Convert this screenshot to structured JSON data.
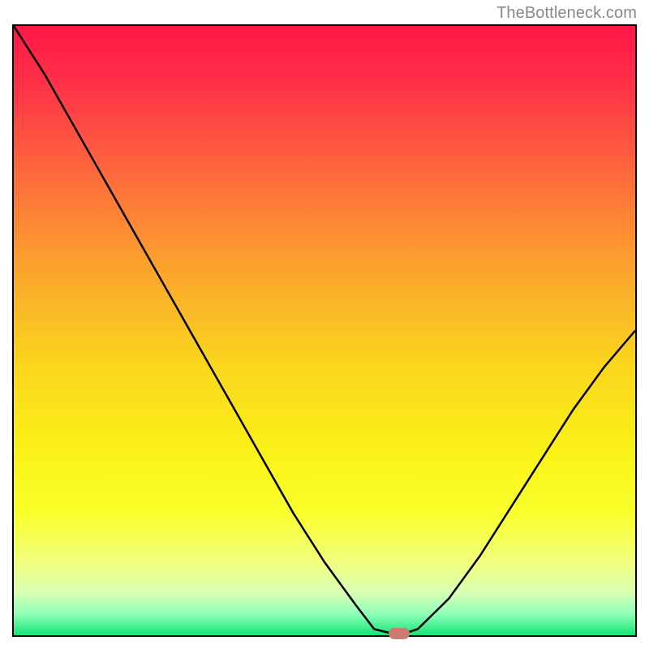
{
  "watermark": "TheBottleneck.com",
  "chart_data": {
    "type": "line",
    "title": "",
    "xlabel": "",
    "ylabel": "",
    "xlim": [
      0,
      100
    ],
    "ylim": [
      0,
      100
    ],
    "grid": false,
    "legend": false,
    "series": [
      {
        "name": "bottleneck-curve",
        "x": [
          0,
          5,
          10,
          15,
          20,
          25,
          30,
          35,
          40,
          45,
          50,
          55,
          58,
          62,
          65,
          70,
          75,
          80,
          85,
          90,
          95,
          100
        ],
        "y": [
          100,
          92,
          83,
          74,
          65,
          56,
          47,
          38,
          29,
          20,
          12,
          5,
          1,
          0,
          1,
          6,
          13,
          21,
          29,
          37,
          44,
          50
        ]
      }
    ],
    "marker": {
      "x": 62,
      "y": 0,
      "color": "#cf7a71"
    },
    "background_gradient": {
      "stops": [
        {
          "pos": 0.0,
          "color": "#ff1747"
        },
        {
          "pos": 0.1,
          "color": "#ff3348"
        },
        {
          "pos": 0.25,
          "color": "#fd6c3b"
        },
        {
          "pos": 0.4,
          "color": "#fba42d"
        },
        {
          "pos": 0.55,
          "color": "#fad41e"
        },
        {
          "pos": 0.7,
          "color": "#faf217"
        },
        {
          "pos": 0.8,
          "color": "#f9ff2c"
        },
        {
          "pos": 0.88,
          "color": "#f1ff7e"
        },
        {
          "pos": 0.93,
          "color": "#d9ffb4"
        },
        {
          "pos": 0.965,
          "color": "#8fffb9"
        },
        {
          "pos": 1.0,
          "color": "#16e576"
        }
      ]
    }
  }
}
